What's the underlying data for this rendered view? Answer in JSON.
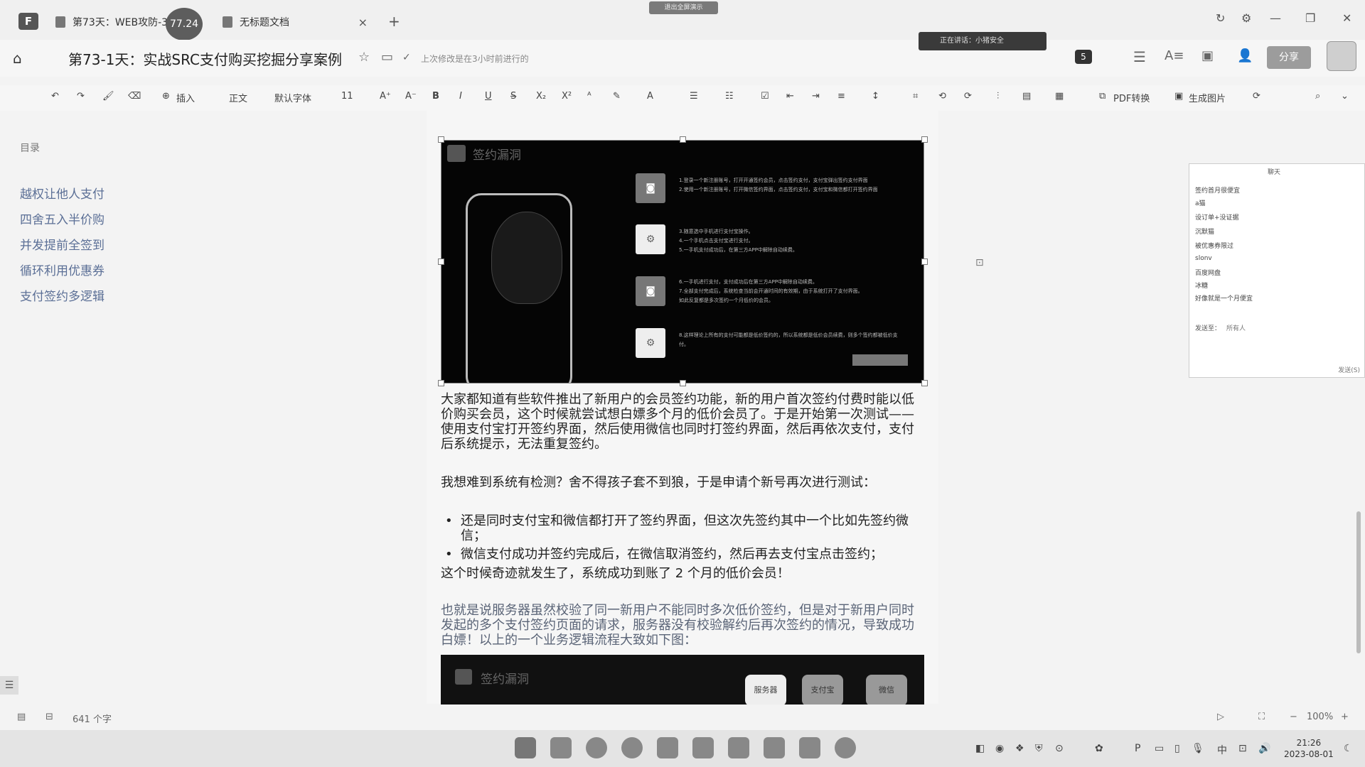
{
  "tabs": {
    "tab1_label": "第73天：WEB攻防-3",
    "tab1_badge": "77.24",
    "tab2_label": "无标题文档",
    "close_glyph": "×",
    "add_glyph": "+"
  },
  "recording_banner": "退出全屏演示",
  "header": {
    "title": "第73-1天：实战SRC支付购买挖掘分享案例",
    "save_status": "上次修改是在3小时前进行的",
    "meeting_status": "正在讲话：小猪安全",
    "collaborators_count": "5",
    "share_label": "分享"
  },
  "toolbar": {
    "insert": "插入",
    "style": "正文",
    "font": "默认字体",
    "size": "11",
    "bold": "B",
    "italic": "I",
    "underline": "U",
    "strike": "S",
    "pdf": "PDF转换",
    "image_gen": "生成图片"
  },
  "sidebar": {
    "title": "目录",
    "items": [
      "越权让他人支付",
      "四舍五入半价购",
      "并发提前全签到",
      "循环利用优惠券",
      "支付签约多逻辑"
    ]
  },
  "image1": {
    "heading": "签约漏洞",
    "steps": [
      "1.登录一个新注册账号，打开开通签约会员，点击签约支付，支付宝弹出签约支付界面\n2.使用一个新注册账号，打开微信签约界面，点击签约支付，支付宝和微信都打开签约界面",
      "3.随意选中手机进行支付宝操作。\n4.一个手机点击支付宝进行支付。\n5.一手机支付成功后，在第三方APP中解除自动续费。",
      "6.一手机进行支付，支付成功后在第三方APP中解除自动续费。\n7.全部支付完成后，系统检查当前会开通时间的有效期，由于系统打开了支付界面。\n如此反复都是多次签约一个月低价的会员。",
      "8.这样理论上所有的支付可能都是低价签约的，所以系统都是低价会员续费，则多个签约都被低价支付。"
    ]
  },
  "doc": {
    "para1": "大家都知道有些软件推出了新用户的会员签约功能，新的用户首次签约付费时能以低价购买会员，这个时候就尝试想白嫖多个月的低价会员了。于是开始第一次测试——使用支付宝打开签约界面，然后使用微信也同时打签约界面，然后再依次支付，支付后系统提示，无法重复签约。",
    "para2": "我想难到系统有检测？舍不得孩子套不到狼，于是申请个新号再次进行测试：",
    "bullet_glyph": "•",
    "bullet1": "还是同时支付宝和微信都打开了签约界面，但这次先签约其中一个比如先签约微信；",
    "bullet2": "微信支付成功并签约完成后，在微信取消签约，然后再去支付宝点击签约；",
    "para3": "这个时候奇迹就发生了，系统成功到账了 2 个月的低价会员！",
    "para4": "也就是说服务器虽然校验了同一新用户不能同时多次低价签约，但是对于新用户同时发起的多个支付签约页面的请求，服务器没有校验解约后再次签约的情况，导致成功白嫖！以上的一个业务逻辑流程大致如下图：",
    "image2_heading": "签约漏洞",
    "image2_nodes": [
      "服务器",
      "支付宝",
      "微信"
    ]
  },
  "chat": {
    "title": "聊天",
    "messages": [
      "签约首月很便宜",
      "a猫",
      "设订单+没证据",
      "沉默猫",
      "被优惠券限过",
      "slonv",
      "百度网盘",
      "冰糖",
      "好像就是一个月便宜"
    ],
    "send_to_label": "发送至：",
    "send_to_value": "所有人",
    "send_button": "发送(S)"
  },
  "statusbar": {
    "word_count": "641 个字",
    "zoom": "100%",
    "zoom_minus": "−",
    "zoom_plus": "+"
  },
  "taskbar": {
    "ime": "中",
    "time": "21:26",
    "date": "2023-08-01"
  }
}
